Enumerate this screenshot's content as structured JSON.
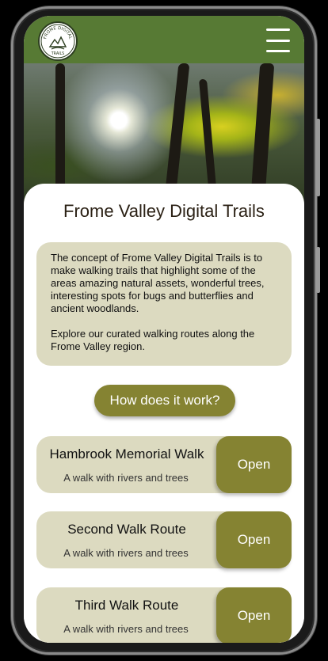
{
  "header": {
    "logo_text": "FROME DIGITAL TRAILS",
    "menu_icon": "hamburger-menu-icon",
    "background_color": "#577a34"
  },
  "main": {
    "title": "Frome Valley Digital Trails",
    "intro_paragraph_1": "The concept of Frome Valley Digital Trails is to make walking trails that highlight some of the areas amazing natural assets, wonderful trees, interesting spots for bugs and butterflies and ancient woodlands.",
    "intro_paragraph_2": "Explore our curated walking routes along the Frome Valley region.",
    "how_button_label": "How does it work?",
    "accent_color": "#858332",
    "panel_color": "#dcdac0"
  },
  "walks": [
    {
      "title": "Hambrook Memorial Walk",
      "subtitle": "A walk with rivers and trees",
      "open_label": "Open"
    },
    {
      "title": "Second Walk Route",
      "subtitle": "A walk with rivers and trees",
      "open_label": "Open"
    },
    {
      "title": "Third Walk Route",
      "subtitle": "A walk with rivers and trees",
      "open_label": "Open"
    }
  ]
}
